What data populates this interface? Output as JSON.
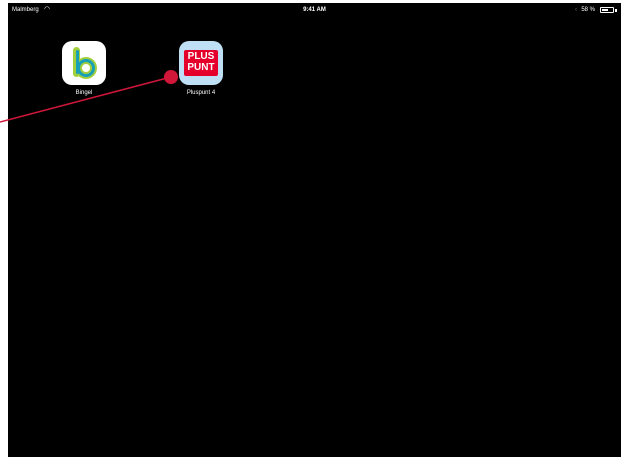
{
  "status_bar": {
    "carrier": "Malmberg",
    "time": "9:41 AM",
    "battery_percent": "58 %",
    "battery_level": 0.58,
    "icons": [
      "wifi-icon",
      "bluetooth-icon",
      "battery-icon"
    ]
  },
  "apps": [
    {
      "label": "Bingel",
      "icon": "bingel-icon"
    },
    {
      "label": "Pluspunt 4",
      "icon": "pluspunt-icon",
      "icon_text_line1": "PLUS",
      "icon_text_line2": "PUNT"
    }
  ],
  "annotation": {
    "color": "#d0173a"
  }
}
